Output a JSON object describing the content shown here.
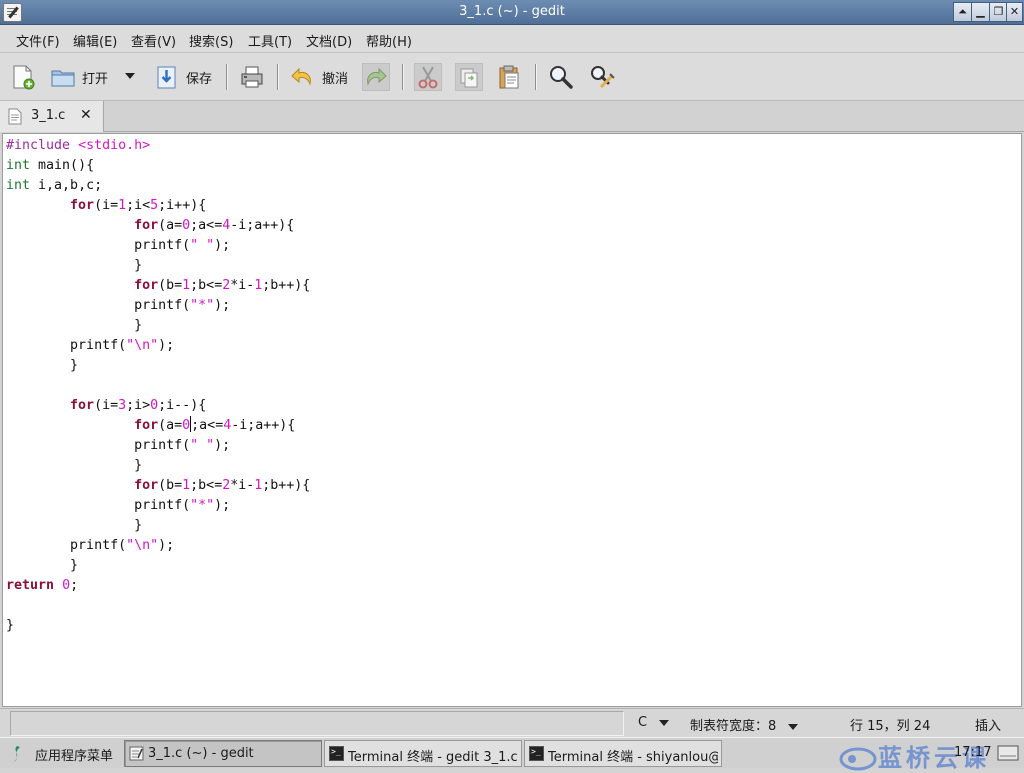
{
  "window": {
    "title": "3_1.c (~) - gedit"
  },
  "menu": [
    "文件(F)",
    "编辑(E)",
    "查看(V)",
    "搜索(S)",
    "工具(T)",
    "文档(D)",
    "帮助(H)"
  ],
  "toolbar": {
    "open_label": "打开",
    "save_label": "保存",
    "undo_label": "撤消"
  },
  "tab": {
    "label": "3_1.c"
  },
  "status": {
    "language": "C",
    "tab_width": "制表符宽度：8",
    "cursor_position": "行 15，列 24",
    "mode": "插入"
  },
  "taskbar": {
    "menu_label": "应用程序菜单",
    "tasks": [
      "3_1.c (~) - gedit",
      "Terminal 终端 - gedit 3_1.c",
      "Terminal 终端 - shiyanlou@f…"
    ],
    "clock": "17:17",
    "watermark": "蓝桥云课"
  },
  "colors": {
    "titlebar": "#5b7ba5",
    "keyword": "#8b0f37",
    "type": "#1a7a2e",
    "literal": "#d415c8",
    "preprocessor": "#9a2ba6"
  }
}
